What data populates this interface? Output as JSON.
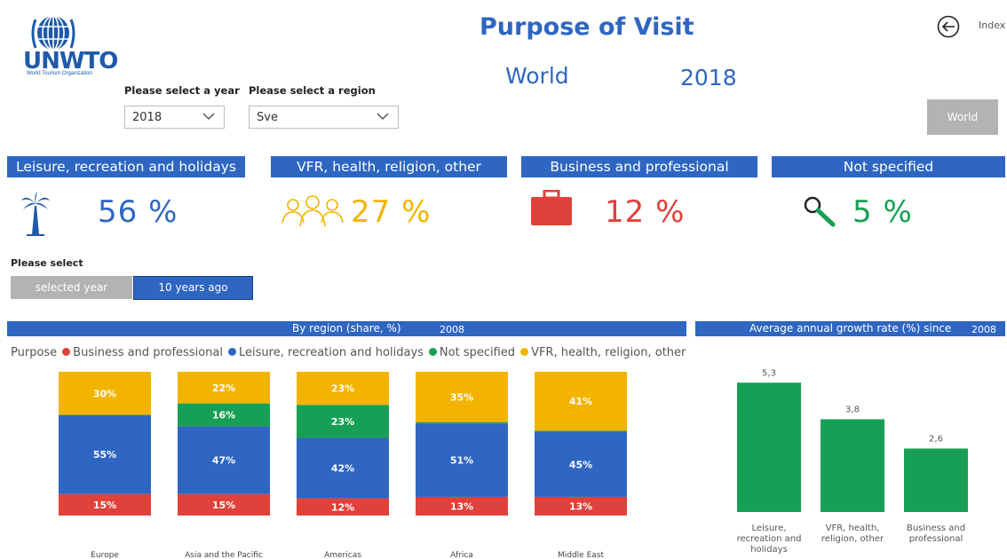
{
  "header": {
    "logo": {
      "name": "UNWTO",
      "subtitle": "World Tourism Organization"
    },
    "title": "Purpose of Visit",
    "region_display": "World",
    "year_display": "2018",
    "index_label": "Index",
    "world_button": "World"
  },
  "filters": {
    "year_label": "Please select a year",
    "year_value": "2018",
    "region_label": "Please select a region",
    "region_value": "Sve"
  },
  "categories": [
    {
      "label": "Leisure, recreation and holidays",
      "value": "56 %",
      "color": "#2e66c2",
      "icon": "palm-tree-icon"
    },
    {
      "label": "VFR, health, religion, other",
      "value": "27 %",
      "color": "#f3b400",
      "icon": "people-group-icon"
    },
    {
      "label": "Business and professional",
      "value": "12 %",
      "color": "#e0413a",
      "icon": "briefcase-icon"
    },
    {
      "label": "Not specified",
      "value": "5 %",
      "color": "#17a055",
      "icon": "magnifier-icon"
    }
  ],
  "toggle": {
    "label": "Please select",
    "option_a": "selected year",
    "option_b": "10 years ago",
    "active": "10 years ago"
  },
  "region_panel": {
    "title": "By region (share, %)",
    "year": "2008"
  },
  "growth_panel": {
    "title": "Average annual growth rate (%) since",
    "year": "2008"
  },
  "legend": {
    "title": "Purpose",
    "items": [
      {
        "label": "Business and professional",
        "color": "#e0413a"
      },
      {
        "label": "Leisure, recreation and holidays",
        "color": "#2e66c2"
      },
      {
        "label": "Not specified",
        "color": "#17a055"
      },
      {
        "label": "VFR, health, religion, other",
        "color": "#f3b400"
      }
    ]
  },
  "chart_data": [
    {
      "type": "bar",
      "stacked": true,
      "title": "By region (share, %)",
      "categories": [
        "Europe",
        "Asia and the Pacific",
        "Americas",
        "Africa",
        "Middle East"
      ],
      "series": [
        {
          "name": "Business and professional",
          "color": "#e0413a",
          "values": [
            15,
            15,
            12,
            13,
            13
          ]
        },
        {
          "name": "Leisure, recreation and holidays",
          "color": "#2e66c2",
          "values": [
            55,
            47,
            42,
            51,
            45
          ]
        },
        {
          "name": "Not specified",
          "color": "#17a055",
          "values": [
            0,
            16,
            23,
            1,
            1
          ]
        },
        {
          "name": "VFR, health, religion, other",
          "color": "#f3b400",
          "values": [
            30,
            22,
            23,
            35,
            41
          ]
        }
      ],
      "labels": [
        [
          "15%",
          "15%",
          "12%",
          "13%",
          "13%"
        ],
        [
          "55%",
          "47%",
          "42%",
          "51%",
          "45%"
        ],
        [
          "",
          "16%",
          "23%",
          "",
          ""
        ],
        [
          "30%",
          "22%",
          "23%",
          "35%",
          "41%"
        ]
      ],
      "ylim": [
        0,
        100
      ]
    },
    {
      "type": "bar",
      "title": "Average annual growth rate (%) since 2008",
      "categories": [
        "Leisure, recreation and holidays",
        "VFR, health, religion, other",
        "Business and professional"
      ],
      "values": [
        5.3,
        3.8,
        2.6
      ],
      "value_labels": [
        "5,3",
        "3,8",
        "2,6"
      ],
      "color": "#17a055"
    }
  ]
}
